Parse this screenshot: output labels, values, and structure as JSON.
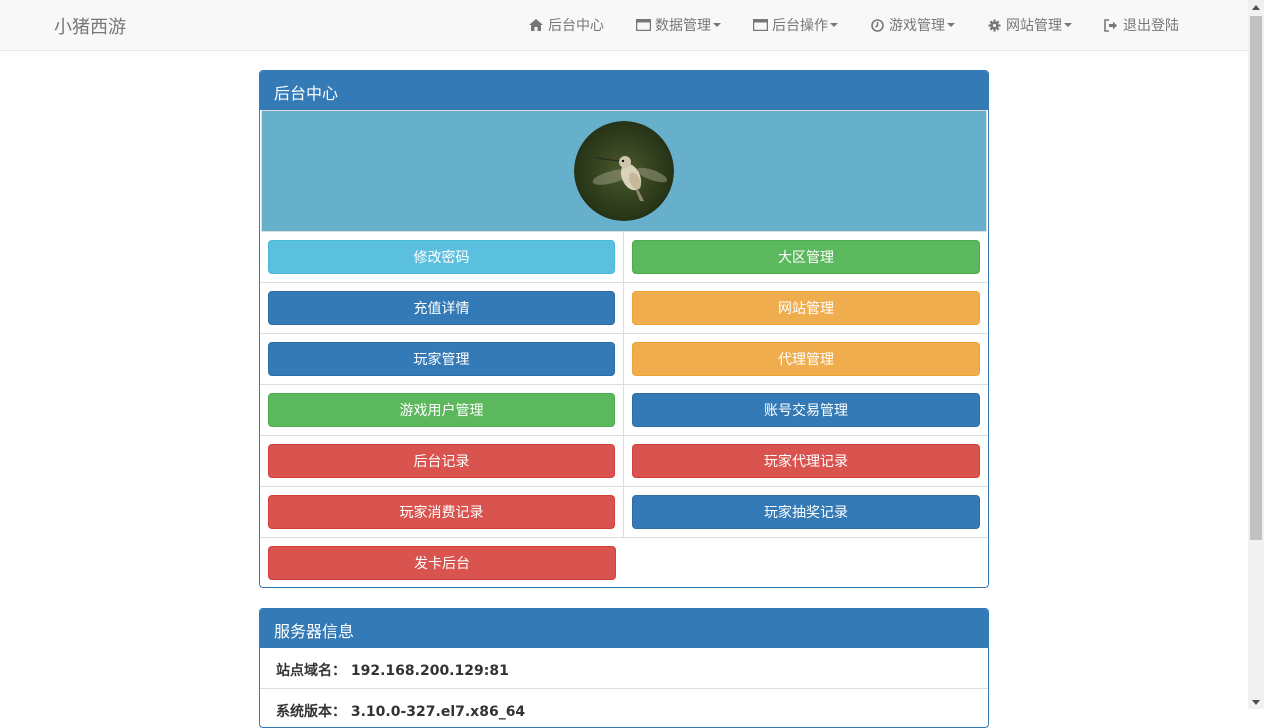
{
  "brand": "小猪西游",
  "nav": {
    "items": [
      {
        "label": "后台中心",
        "icon": "home-icon",
        "dropdown": false
      },
      {
        "label": "数据管理",
        "icon": "window-icon",
        "dropdown": true
      },
      {
        "label": "后台操作",
        "icon": "window-icon",
        "dropdown": true
      },
      {
        "label": "游戏管理",
        "icon": "clock-icon",
        "dropdown": true
      },
      {
        "label": "网站管理",
        "icon": "gear-icon",
        "dropdown": true
      },
      {
        "label": "退出登陆",
        "icon": "logout-icon",
        "dropdown": false
      }
    ]
  },
  "main_panel": {
    "title": "后台中心",
    "avatar": "hummingbird-avatar",
    "buttons": [
      {
        "label": "修改密码",
        "style": "info"
      },
      {
        "label": "大区管理",
        "style": "success"
      },
      {
        "label": "充值详情",
        "style": "primary"
      },
      {
        "label": "网站管理",
        "style": "warning"
      },
      {
        "label": "玩家管理",
        "style": "primary"
      },
      {
        "label": "代理管理",
        "style": "warning"
      },
      {
        "label": "游戏用户管理",
        "style": "success"
      },
      {
        "label": "账号交易管理",
        "style": "primary"
      },
      {
        "label": "后台记录",
        "style": "danger"
      },
      {
        "label": "玩家代理记录",
        "style": "danger"
      },
      {
        "label": "玩家消费记录",
        "style": "danger"
      },
      {
        "label": "玩家抽奖记录",
        "style": "primary"
      },
      {
        "label": "发卡后台",
        "style": "danger"
      }
    ]
  },
  "server_panel": {
    "title": "服务器信息",
    "rows": [
      {
        "label": "站点域名：",
        "value": "192.168.200.129:81"
      },
      {
        "label": "系统版本：",
        "value": "3.10.0-327.el7.x86_64"
      }
    ]
  },
  "colors": {
    "primary": "#337ab7",
    "info": "#5bc0de",
    "success": "#5cb85c",
    "warning": "#f0ad4e",
    "danger": "#d9534f",
    "avatar_bg": "#67b0cc"
  }
}
